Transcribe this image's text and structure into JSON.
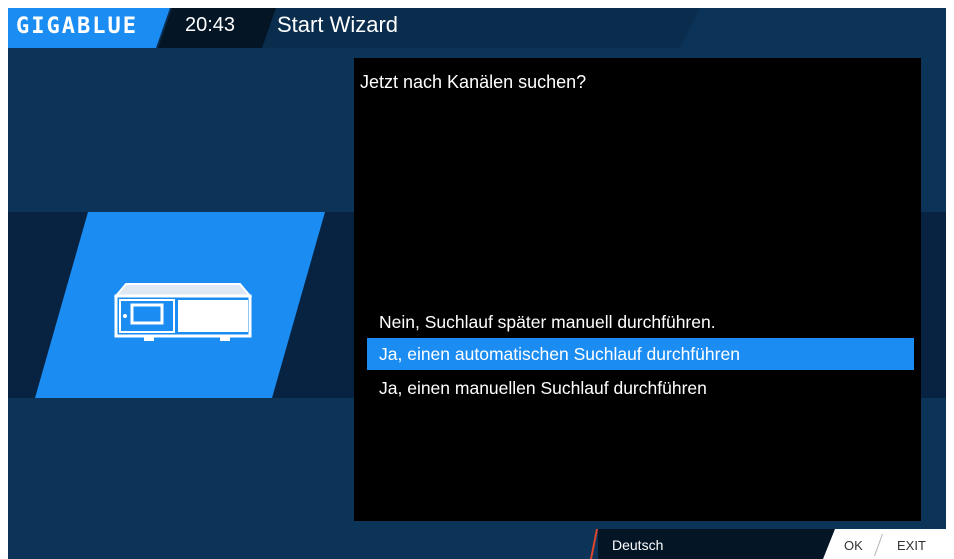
{
  "header": {
    "logo": "GIGABLUE",
    "time": "20:43",
    "title": "Start Wizard"
  },
  "dialog": {
    "question": "Jetzt nach Kanälen suchen?",
    "options": [
      {
        "label": "Nein, Suchlauf später manuell durchführen.",
        "selected": false
      },
      {
        "label": "Ja, einen automatischen Suchlauf durchführen",
        "selected": true
      },
      {
        "label": "Ja, einen manuellen Suchlauf durchführen",
        "selected": false
      }
    ]
  },
  "footer": {
    "language": "Deutsch",
    "ok_label": "OK",
    "exit_label": "EXIT"
  },
  "colors": {
    "accent": "#1a8cf2",
    "background": "#0c3459",
    "dialog": "#000000",
    "language_marker": "#e0452b"
  },
  "icons": {
    "wizard_image": "set-top-box-receiver-icon"
  }
}
